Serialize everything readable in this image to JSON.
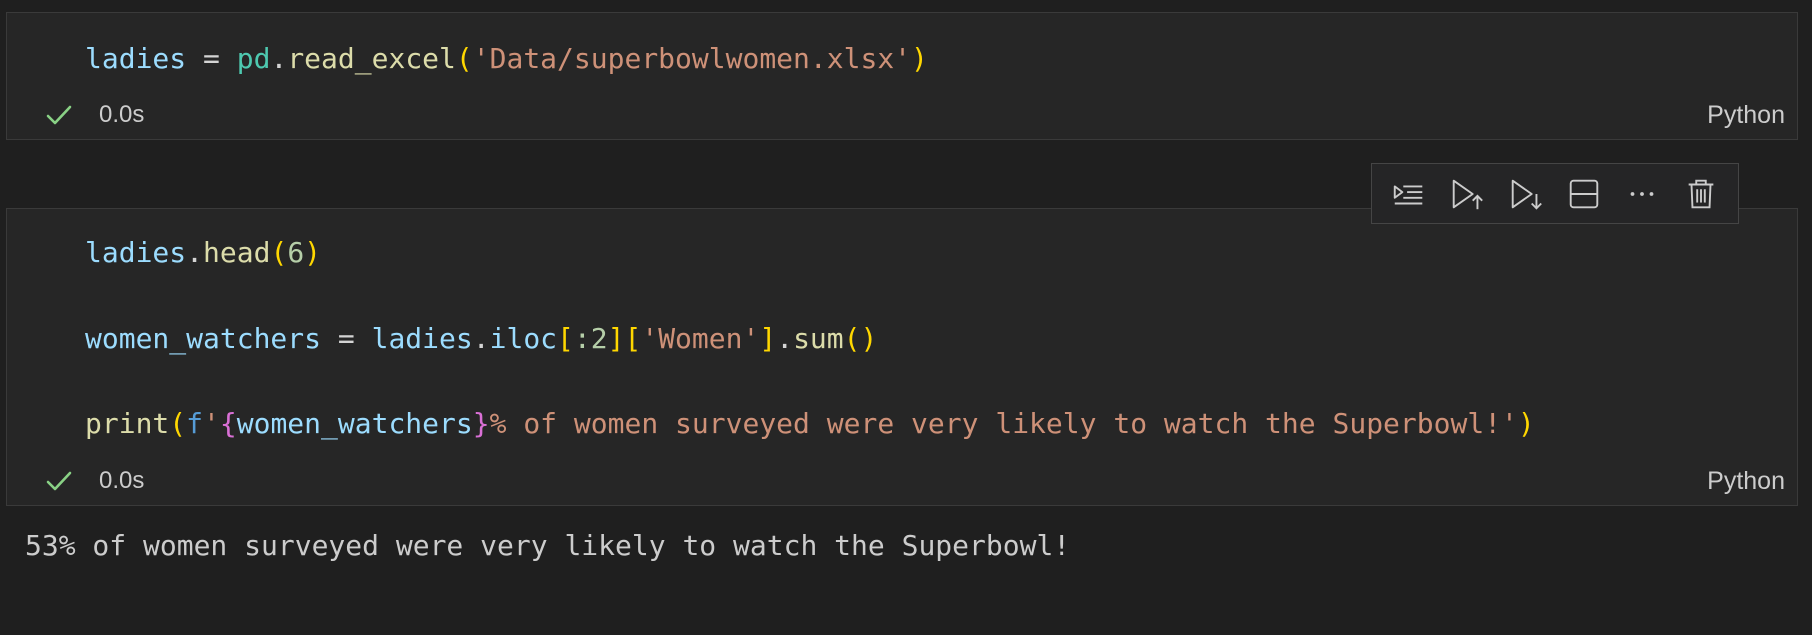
{
  "cells": [
    {
      "language": "Python",
      "exec_time": "0.0s",
      "status_icon": "check-icon",
      "code": {
        "line1": {
          "var": "ladies",
          "eq": " = ",
          "mod": "pd",
          "dot": ".",
          "fn": "read_excel",
          "lp": "(",
          "str": "'Data/superbowlwomen.xlsx'",
          "rp": ")"
        }
      }
    },
    {
      "language": "Python",
      "exec_time": "0.0s",
      "status_icon": "check-icon",
      "code": {
        "line1": {
          "var": "ladies",
          "dot": ".",
          "fn": "head",
          "lp": "(",
          "num": "6",
          "rp": ")"
        },
        "line2": {
          "var": "women_watchers",
          "eq": " = ",
          "var2": "ladies",
          "dot": ".",
          "attr": "iloc",
          "lb": "[",
          "slice": ":2",
          "rb": "]",
          "lb2": "[",
          "str": "'Women'",
          "rb2": "]",
          "dot2": ".",
          "fn": "sum",
          "parens": "()"
        },
        "line3": {
          "fn": "print",
          "lp": "(",
          "prefix": "f",
          "q1": "'",
          "lbrace": "{",
          "var": "women_watchers",
          "rbrace": "}",
          "rest": "% of women surveyed were very likely to watch the Superbowl!'",
          "rp": ")"
        }
      },
      "output": "53% of women surveyed were very likely to watch the Superbowl!"
    }
  ],
  "toolbar": {
    "buttons": [
      {
        "icon": "execute-above-cells-icon"
      },
      {
        "icon": "run-above-icon"
      },
      {
        "icon": "run-below-icon"
      },
      {
        "icon": "split-cell-icon"
      },
      {
        "icon": "more-actions-icon"
      },
      {
        "icon": "delete-cell-icon"
      }
    ]
  },
  "colors": {
    "background": "#1f1f1f",
    "cell_background": "#262626",
    "success_check": "#89d185",
    "variable": "#9cdcfe",
    "module": "#4ec9b0",
    "function": "#dcdcaa",
    "string": "#ce9178",
    "number": "#b5cea8",
    "keyword": "#569cd6",
    "bracket_level1": "#ffd700",
    "bracket_level2": "#da70d6"
  }
}
